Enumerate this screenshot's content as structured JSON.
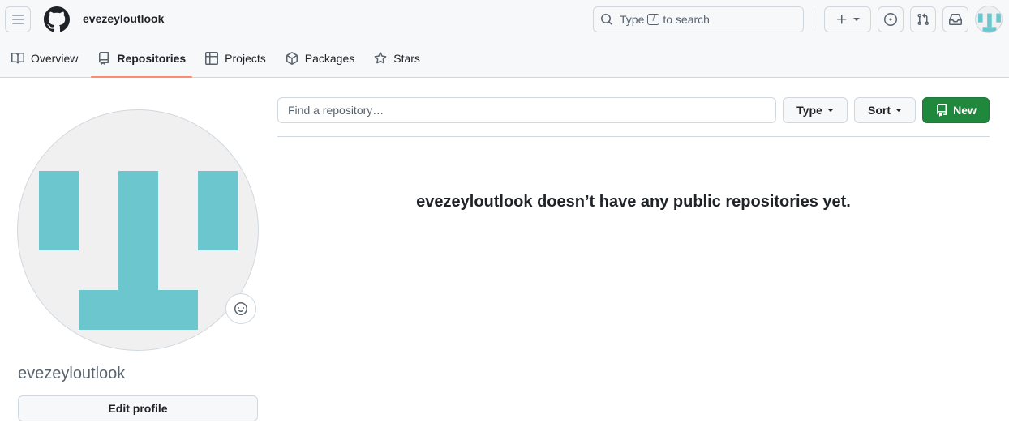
{
  "header": {
    "owner": "evezeyloutlook",
    "search": {
      "prefix": "Type",
      "key": "/",
      "suffix": "to search"
    }
  },
  "nav": {
    "tabs": [
      {
        "label": "Overview",
        "icon": "book-icon"
      },
      {
        "label": "Repositories",
        "icon": "repo-icon",
        "selected": true
      },
      {
        "label": "Projects",
        "icon": "table-icon"
      },
      {
        "label": "Packages",
        "icon": "package-icon"
      },
      {
        "label": "Stars",
        "icon": "star-icon"
      }
    ]
  },
  "profile": {
    "login": "evezeyloutlook",
    "edit_label": "Edit profile"
  },
  "repos": {
    "search_placeholder": "Find a repository…",
    "type_label": "Type",
    "sort_label": "Sort",
    "new_label": "New",
    "empty_message": "evezeyloutlook doesn’t have any public repositories yet."
  },
  "colors": {
    "accent_green": "#1f883d",
    "tab_underline": "#fd8c73",
    "identicon": "#6cc6cd"
  }
}
